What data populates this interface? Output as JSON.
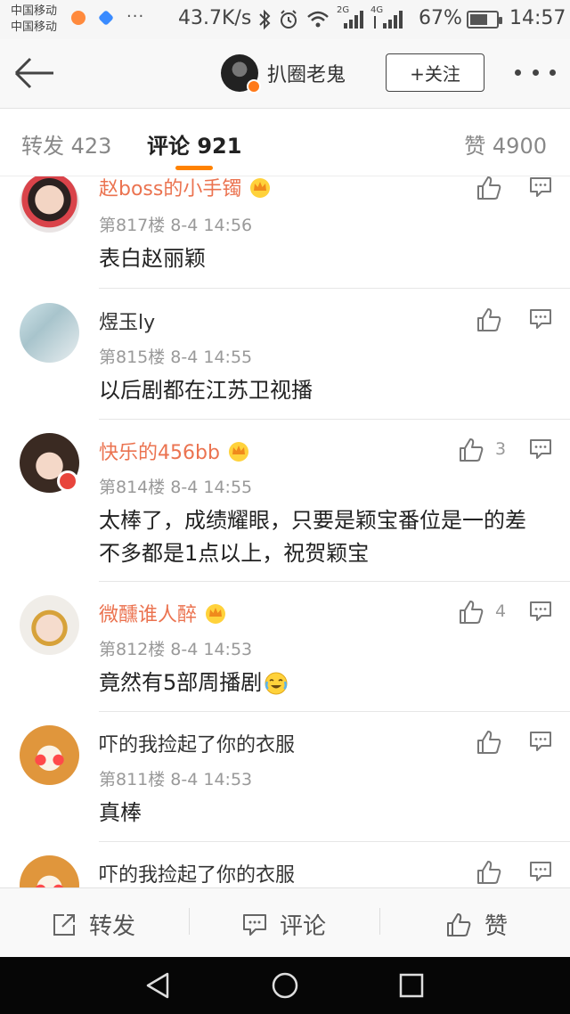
{
  "status_bar": {
    "carrier_1": "中国移动",
    "carrier_2": "中国移动",
    "more": "···",
    "network_speed": "43.7K/s",
    "network_label_1": "2G",
    "network_label_2": "4G",
    "battery_percent": "67%",
    "battery_level": 0.67,
    "time": "14:57"
  },
  "header": {
    "username": "扒圈老鬼",
    "follow_label": "+关注"
  },
  "tabs": {
    "repost": "转发 423",
    "comment": "评论 921",
    "like": "赞 4900"
  },
  "comments": [
    {
      "name": "赵boss的小手镯",
      "vip": true,
      "meta": "第817楼  8-4 14:56",
      "text": "表白赵丽颖",
      "likes": ""
    },
    {
      "name": "煜玉ly",
      "vip": false,
      "meta": "第815楼  8-4 14:55",
      "text": "以后剧都在江苏卫视播",
      "likes": ""
    },
    {
      "name": "快乐的456bb",
      "vip": true,
      "meta": "第814楼  8-4 14:55",
      "text": "太棒了，成绩耀眼，只要是颖宝番位是一的差不多都是1点以上，祝贺颖宝",
      "likes": "3"
    },
    {
      "name": "微醺谁人醉",
      "vip": true,
      "meta": "第812楼  8-4 14:53",
      "text": "竟然有5部周播剧",
      "likes": "4"
    },
    {
      "name": "吓的我捡起了你的衣服",
      "vip": false,
      "meta": "第811楼  8-4 14:53",
      "text": "真棒",
      "likes": ""
    },
    {
      "name": "吓的我捡起了你的衣服",
      "vip": false,
      "meta": "",
      "text": "",
      "likes": ""
    }
  ],
  "action_bar": {
    "repost": "转发",
    "comment": "评论",
    "like": "赞"
  },
  "colors": {
    "accent": "#ff8200",
    "vip_name": "#eb7350"
  },
  "icons": [
    "back-arrow-icon",
    "bluetooth-icon",
    "alarm-icon",
    "wifi-icon",
    "signal-icon",
    "battery-icon",
    "more-icon",
    "thumb-up-icon",
    "reply-icon",
    "share-icon",
    "comment-icon",
    "crown-icon",
    "triangle-back-icon",
    "circle-home-icon",
    "square-recent-icon"
  ]
}
